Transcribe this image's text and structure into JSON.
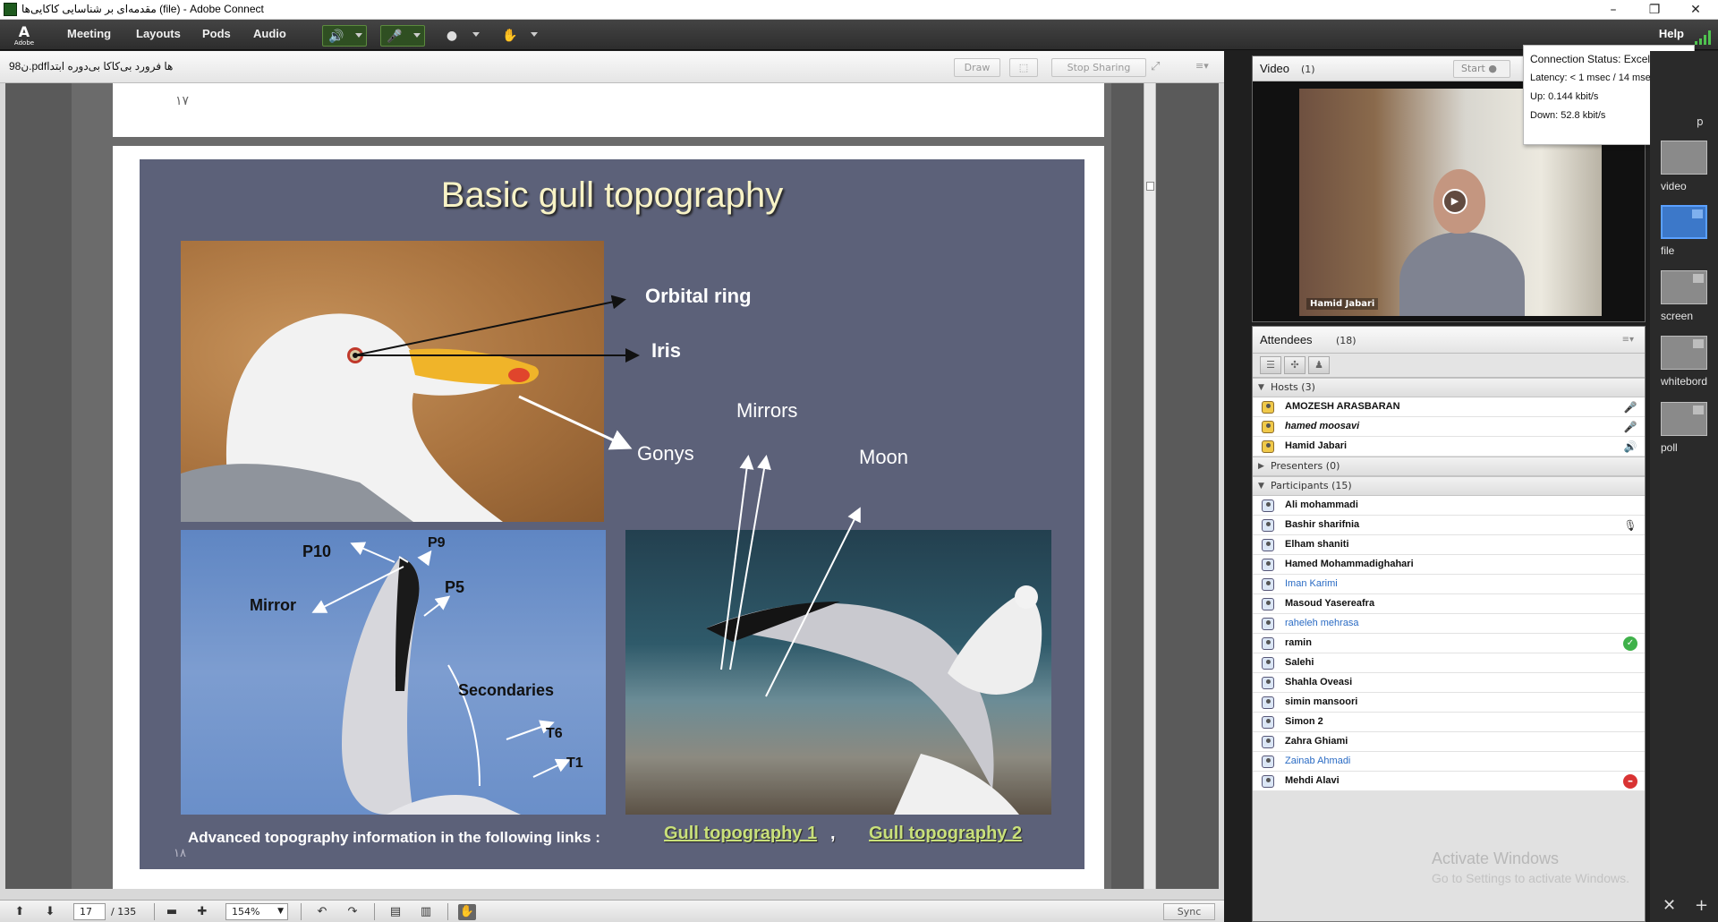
{
  "window": {
    "title": "مقدمه‌ای بر شناسایی کاکایی‌ها (file) - Adobe Connect",
    "minimize": "–",
    "maximize": "❐",
    "close": "✕"
  },
  "menubar": {
    "logo_text": "Adobe",
    "items": [
      "Meeting",
      "Layouts",
      "Pods",
      "Audio"
    ],
    "help": "Help"
  },
  "share": {
    "filename": "98ن.pdfها فرورد بی‌کاکا بی‌دوره ابتدا",
    "buttons": {
      "draw": "Draw",
      "stop_sharing": "Stop Sharing"
    },
    "page17_number": "۱۷"
  },
  "slide": {
    "title": "Basic gull topography",
    "labels": {
      "orbital_ring": "Orbital ring",
      "iris": "Iris",
      "gonys": "Gonys",
      "mirrors": "Mirrors",
      "moon": "Moon",
      "p10": "P10",
      "p9": "P9",
      "p5": "P5",
      "mirror": "Mirror",
      "secondaries": "Secondaries",
      "t6": "T6",
      "t1": "T1"
    },
    "footer": "Advanced topography information in the following links   :",
    "link1": "Gull topography 1",
    "link_sep": ",",
    "link2": "Gull topography 2",
    "page_number": "۱۸"
  },
  "footer_toolbar": {
    "page": "17",
    "total": "/ 135",
    "zoom": "154%",
    "sync": "Sync"
  },
  "video": {
    "title": "Video",
    "count": "(1)",
    "start": "Start",
    "presenter": "Hamid Jabari"
  },
  "connection": {
    "status": "Connection Status:  Excellent",
    "latency": "Latency:  < 1 msec / 14 msec",
    "up": "Up:  0.144 kbit/s",
    "down": "Down:  52.8 kbit/s"
  },
  "attendees": {
    "title": "Attendees",
    "count": "(18)",
    "hosts_label": "Hosts (3)",
    "presenters_label": "Presenters (0)",
    "participants_label": "Participants (15)",
    "hosts": [
      {
        "name": "AMOZESH ARASBARAN",
        "status": "mic-off"
      },
      {
        "name": "hamed moosavi",
        "status": "mic-off"
      },
      {
        "name": "Hamid Jabari",
        "status": "speaker"
      }
    ],
    "participants": [
      {
        "name": "Ali mohammadi",
        "status": ""
      },
      {
        "name": "Bashir sharifnia",
        "status": "mic"
      },
      {
        "name": "Elham shaniti",
        "status": ""
      },
      {
        "name": "Hamed Mohammadighahari",
        "status": ""
      },
      {
        "name": "Iman Karimi",
        "status": ""
      },
      {
        "name": "Masoud Yasereafra",
        "status": ""
      },
      {
        "name": "raheleh mehrasa",
        "status": ""
      },
      {
        "name": "ramin",
        "status": "agree"
      },
      {
        "name": "Salehi",
        "status": ""
      },
      {
        "name": "Shahla Oveasi",
        "status": ""
      },
      {
        "name": "simin mansoori",
        "status": ""
      },
      {
        "name": "Simon 2",
        "status": ""
      },
      {
        "name": "Zahra Ghiami",
        "status": ""
      },
      {
        "name": "Zainab Ahmadi",
        "status": ""
      },
      {
        "name": "Mehdi Alavi",
        "status": "away"
      }
    ],
    "watermark_title": "Activate Windows",
    "watermark_sub": "Go to Settings to activate Windows."
  },
  "layouts": {
    "items": [
      "video",
      "file",
      "screen",
      "whitebord",
      "poll"
    ],
    "partial_label": "p"
  }
}
